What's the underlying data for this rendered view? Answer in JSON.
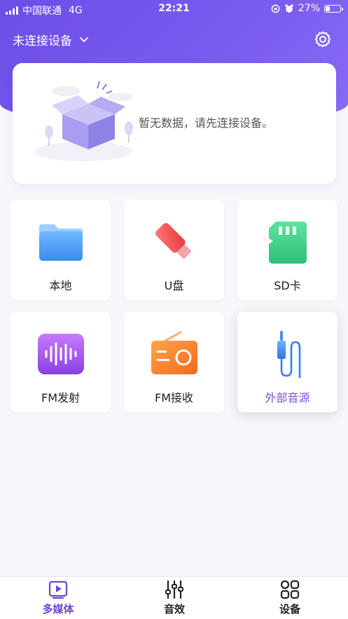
{
  "status_bar": {
    "carrier": "中国联通",
    "network": "4G",
    "time": "22:21",
    "battery_text": "27%",
    "battery_level": 0.27
  },
  "header": {
    "device_status": "未连接设备"
  },
  "empty_state": {
    "message": "暂无数据，请先连接设备。"
  },
  "tiles": [
    {
      "label": "本地",
      "icon": "folder-icon"
    },
    {
      "label": "U盘",
      "icon": "usb-drive-icon"
    },
    {
      "label": "SD卡",
      "icon": "sd-card-icon"
    },
    {
      "label": "FM发射",
      "icon": "fm-transmit-icon"
    },
    {
      "label": "FM接收",
      "icon": "radio-icon"
    },
    {
      "label": "外部音源",
      "icon": "aux-cable-icon",
      "selected": true
    }
  ],
  "tabbar": {
    "tabs": [
      {
        "label": "多媒体",
        "icon": "play-icon",
        "active": true
      },
      {
        "label": "音效",
        "icon": "equalizer-icon"
      },
      {
        "label": "设备",
        "icon": "grid-icon"
      }
    ]
  },
  "colors": {
    "accent": "#6b45d8",
    "header_gradient_start": "#6d4de6",
    "header_gradient_end": "#8a6cf5"
  }
}
